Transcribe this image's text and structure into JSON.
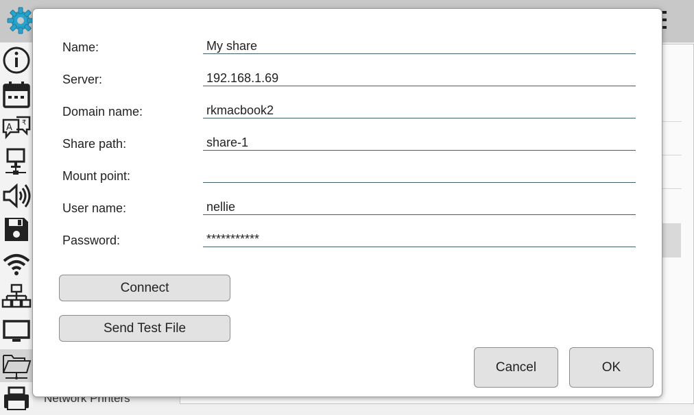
{
  "form": {
    "name": {
      "label": "Name:",
      "value": "My share"
    },
    "server": {
      "label": "Server:",
      "value": "192.168.1.69"
    },
    "domain": {
      "label": "Domain name:",
      "value": "rkmacbook2"
    },
    "share_path": {
      "label": "Share path:",
      "value": "share-1"
    },
    "mount_point": {
      "label": "Mount point:",
      "value": ""
    },
    "user_name": {
      "label": "User name:",
      "value": "nellie"
    },
    "password": {
      "label": "Password:",
      "value": "***********"
    }
  },
  "actions": {
    "connect": "Connect",
    "send_test_file": "Send Test File",
    "cancel": "Cancel",
    "ok": "OK"
  },
  "background": {
    "list_label": "Network Printers"
  },
  "icons": {
    "app": "gear-icon",
    "menu": "overflow-menu-icon",
    "sidebar": [
      "info-icon",
      "calendar-icon",
      "language-icon",
      "network-computer-icon",
      "volume-icon",
      "save-icon",
      "wifi-icon",
      "network-tree-icon",
      "monitor-icon",
      "folder-share-icon",
      "printer-icon"
    ]
  },
  "colors": {
    "accent": "#29a3cc",
    "underline": "#3e5f66",
    "button_bg": "#e2e2e2"
  }
}
